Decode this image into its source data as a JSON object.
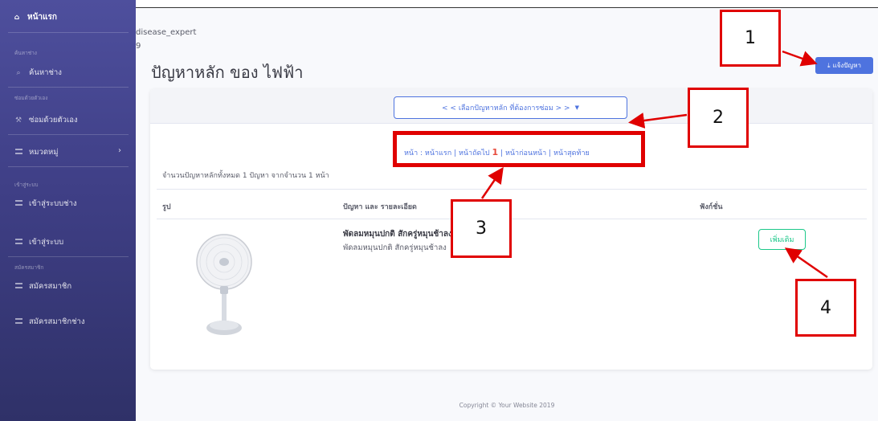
{
  "sidebar": {
    "home": "หน้าแรก",
    "head_search": "ค้นหาช่าง",
    "search_item": "ค้นหาช่าง",
    "head_self": "ซ่อมด้วยตัวเอง",
    "self_item": "ซ่อมด้วยตัวเอง",
    "category_item": "หมวดหมู่",
    "head_login": "เข้าสู่ระบบ",
    "login_tech": "เข้าสู่ระบบช่าง",
    "login": "เข้าสู่ระบบ",
    "head_register": "สมัครสมาชิก",
    "register": "สมัครสมาชิก",
    "register_tech": "สมัครสมาชิกช่าง"
  },
  "header": {
    "username": "disease_expert",
    "user_sub": "9",
    "title": "ปัญหาหลัก ของ ไฟฟ้า",
    "report_button": "แจ้งปัญหา"
  },
  "card": {
    "select_label": "< < เลือกปัญหาหลัก ที่ต้องการซ่อม > >",
    "pagination": {
      "prefix": "หน้า :",
      "first": "หน้าแรก",
      "next": "หน้าถัดไป",
      "current": "1",
      "prev": "หน้าก่อนหน้า",
      "last": "หน้าสุดท้าย"
    },
    "summary": "จำนวนปัญหาหลักทั้งหมด 1 ปัญหา จากจำนวน 1 หน้า",
    "columns": [
      "รูป",
      "ปัญหา และ รายละเอียด",
      "ฟังก์ชั่น"
    ],
    "rows": [
      {
        "name": "พัดลมหมุนปกติ สักครู่หมุนช้าลง",
        "desc": "พัดลมหมุนปกติ สักครู่หมุนช้าลง",
        "action": "เพิ่มเติม"
      }
    ]
  },
  "footer": "Copyright © Your Website 2019",
  "annotations": [
    "1",
    "2",
    "3",
    "4"
  ],
  "colors": {
    "sidebar": "#4e4f9d",
    "primary": "#4e73df",
    "success": "#1cc88a",
    "annotation": "#e00000"
  }
}
